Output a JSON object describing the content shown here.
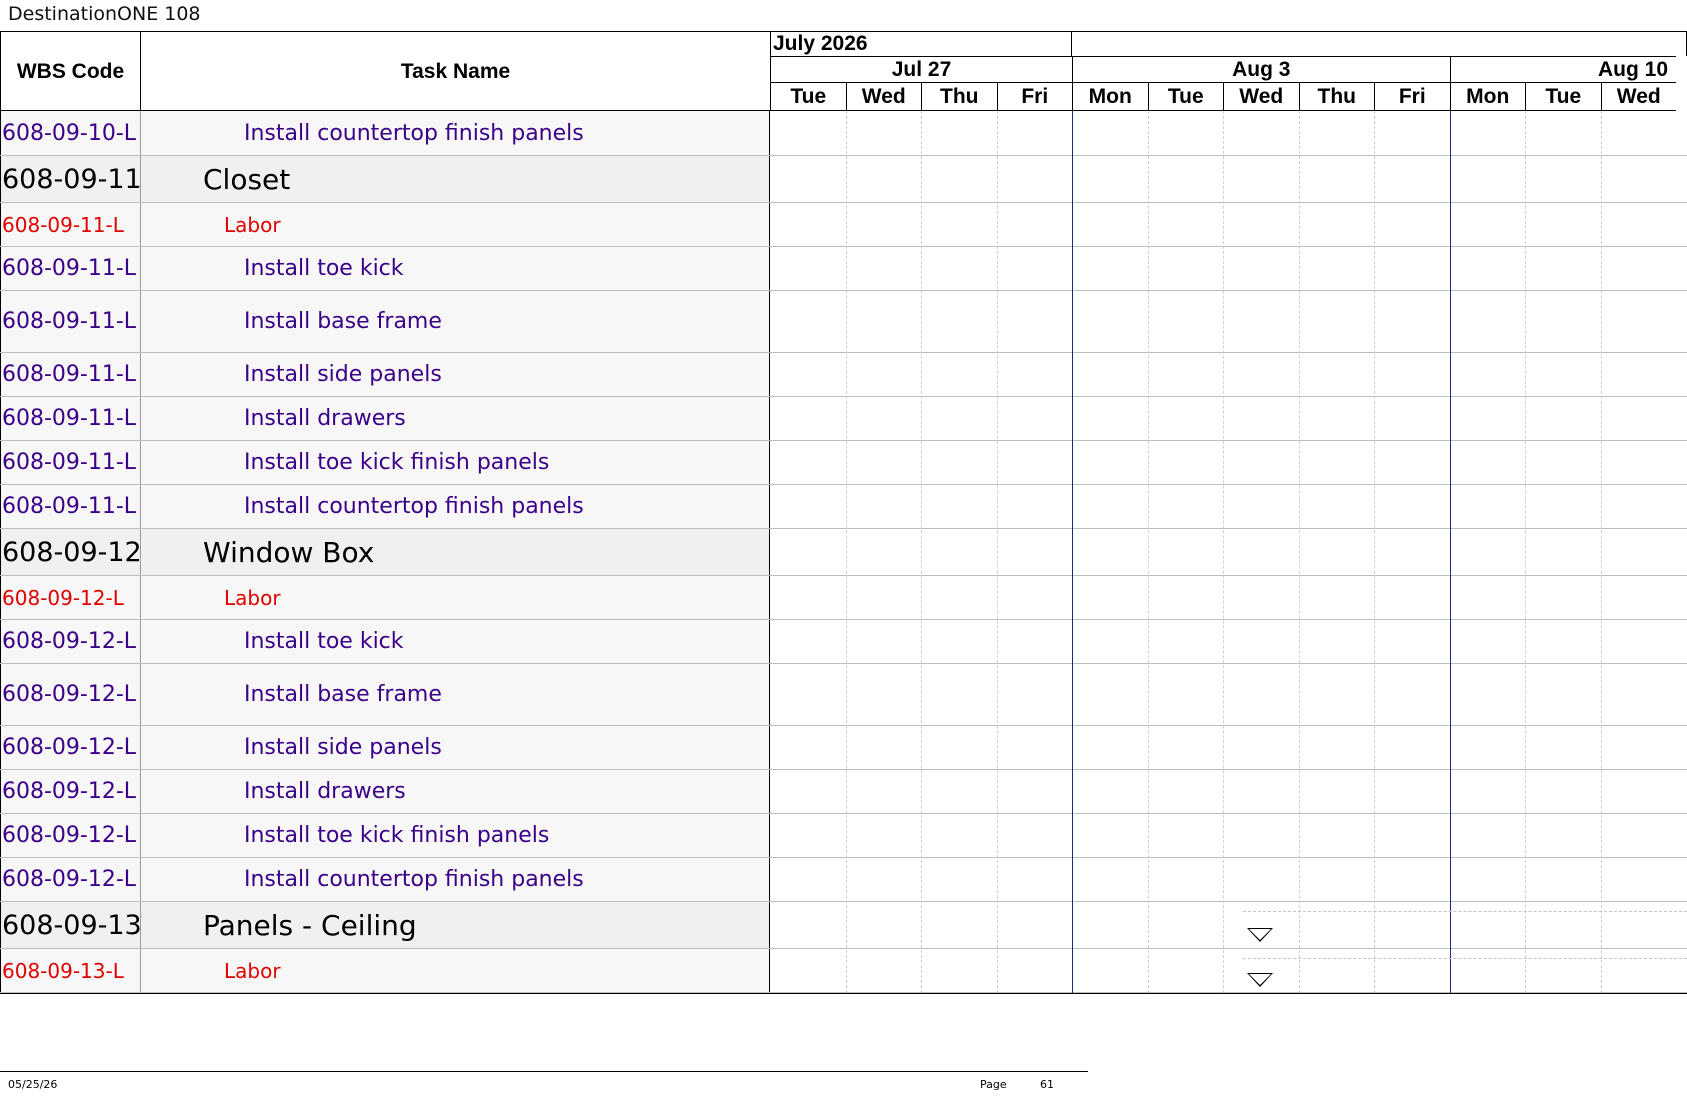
{
  "document": {
    "title": "DestinationONE 108"
  },
  "columns": {
    "wbs": "WBS Code",
    "task": "Task Name"
  },
  "timeline": {
    "month": "July 2026",
    "weeks": [
      "Jul 27",
      "Aug 3",
      "Aug 10"
    ],
    "days": [
      "Tue",
      "Wed",
      "Thu",
      "Fri",
      "Mon",
      "Tue",
      "Wed",
      "Thu",
      "Fri",
      "Mon",
      "Tue",
      "Wed"
    ]
  },
  "rows": [
    {
      "type": "item",
      "wbs": "608-09-10-L (",
      "task": "Install countertop finish panels"
    },
    {
      "type": "group",
      "wbs": "608-09-11",
      "task": "Closet"
    },
    {
      "type": "labor",
      "wbs": "608-09-11-L",
      "task": "Labor"
    },
    {
      "type": "item",
      "wbs": "608-09-11-L (",
      "task": "Install toe kick"
    },
    {
      "type": "item",
      "wbs": "608-09-11-L (",
      "task": "Install base frame"
    },
    {
      "type": "item",
      "wbs": "608-09-11-L (",
      "task": "Install side panels"
    },
    {
      "type": "item",
      "wbs": "608-09-11-L (",
      "task": "Install drawers"
    },
    {
      "type": "item",
      "wbs": "608-09-11-L (",
      "task": "Install toe kick finish panels"
    },
    {
      "type": "item",
      "wbs": "608-09-11-L (",
      "task": "Install countertop finish panels"
    },
    {
      "type": "group",
      "wbs": "608-09-12",
      "task": "Window Box"
    },
    {
      "type": "labor",
      "wbs": "608-09-12-L",
      "task": "Labor"
    },
    {
      "type": "item",
      "wbs": "608-09-12-L (",
      "task": "Install toe kick"
    },
    {
      "type": "item",
      "wbs": "608-09-12-L (",
      "task": "Install base frame"
    },
    {
      "type": "item",
      "wbs": "608-09-12-L (",
      "task": "Install side panels"
    },
    {
      "type": "item",
      "wbs": "608-09-12-L (",
      "task": "Install drawers"
    },
    {
      "type": "item",
      "wbs": "608-09-12-L (",
      "task": "Install toe kick finish panels"
    },
    {
      "type": "item",
      "wbs": "608-09-12-L (",
      "task": "Install countertop finish panels"
    },
    {
      "type": "group",
      "wbs": "608-09-13",
      "task": "Panels - Ceiling",
      "marker_day": "Aug 5"
    },
    {
      "type": "labor",
      "wbs": "608-09-13-L",
      "task": "Labor",
      "marker_day": "Aug 5"
    }
  ],
  "footer": {
    "date": "05/25/26",
    "page_label": "Page",
    "page_number": "61"
  },
  "colors": {
    "group": "#000000",
    "labor": "#e00000",
    "item": "#3a0088",
    "week_line": "#1a2a7a"
  }
}
